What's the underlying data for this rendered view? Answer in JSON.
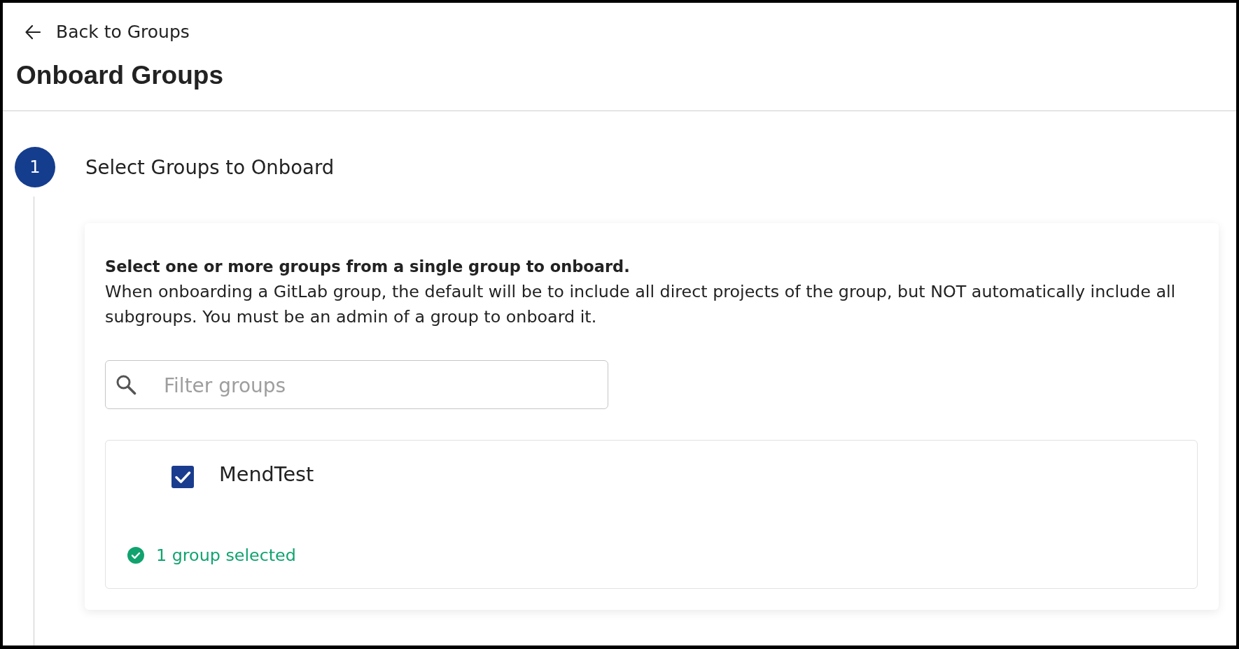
{
  "back_link": {
    "label": "Back to Groups"
  },
  "page_title": "Onboard Groups",
  "step": {
    "number": "1",
    "title": "Select Groups to Onboard"
  },
  "panel": {
    "heading": "Select one or more groups from a single group to onboard.",
    "description": "When onboarding a GitLab group, the default will be to include all direct projects of the group, but NOT automatically include all subgroups. You must be an admin of a group to onboard it.",
    "filter": {
      "placeholder": "Filter groups"
    },
    "groups": [
      {
        "name": "MendTest",
        "checked": true
      }
    ],
    "status": "1 group selected"
  }
}
